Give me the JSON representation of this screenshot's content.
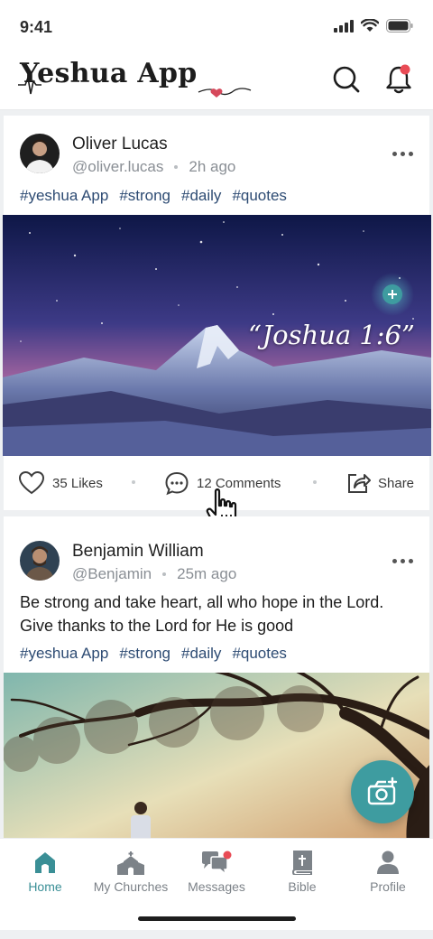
{
  "status_bar": {
    "time": "9:41"
  },
  "app_bar": {
    "title": "Yeshua App"
  },
  "posts": [
    {
      "author": "Oliver Lucas",
      "handle": "@oliver.lucas",
      "time": "2h ago",
      "tags": [
        "#yeshua App",
        "#strong",
        "#daily",
        "#quotes"
      ],
      "image_caption": "“Joshua 1:6”",
      "likes": "35 Likes",
      "comments": "12 Comments",
      "share": "Share"
    },
    {
      "author": "Benjamin William",
      "handle": "@Benjamin",
      "time": "25m ago",
      "text": "Be strong and take heart, all who hope in the Lord. Give thanks to the Lord for He is good",
      "tags": [
        "#yeshua App",
        "#strong",
        "#daily",
        "#quotes"
      ]
    }
  ],
  "tab_bar": {
    "items": [
      {
        "label": "Home",
        "icon": "home-icon",
        "active": true
      },
      {
        "label": "My Churches",
        "icon": "church-icon"
      },
      {
        "label": "Messages",
        "icon": "messages-icon",
        "badge": true
      },
      {
        "label": "Bible",
        "icon": "bible-icon"
      },
      {
        "label": "Profile",
        "icon": "profile-icon"
      }
    ]
  },
  "colors": {
    "accent": "#3e9ca0",
    "tag": "#2d4b73",
    "notification": "#e94b55"
  }
}
